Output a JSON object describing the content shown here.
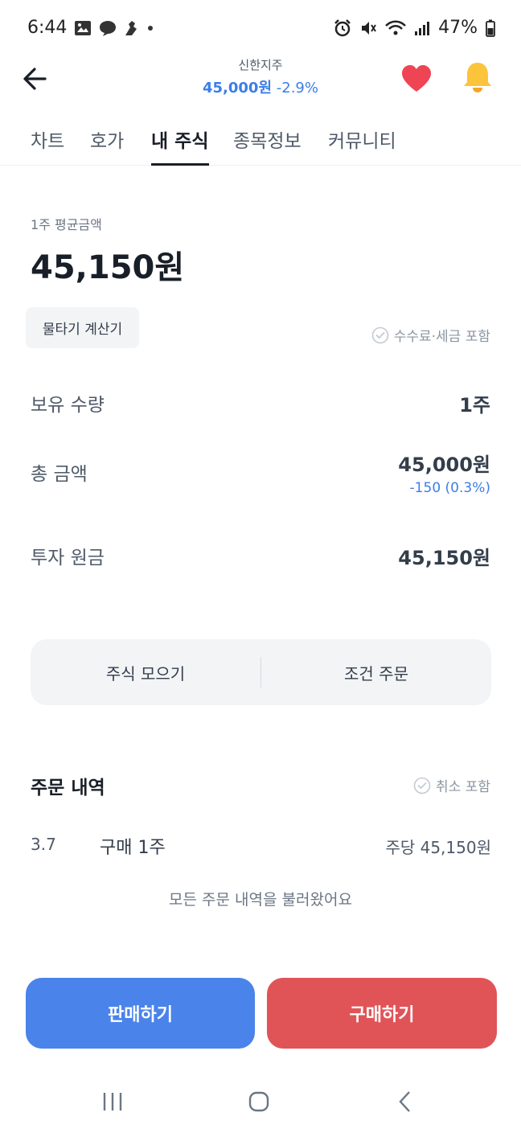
{
  "status_bar": {
    "time": "6:44",
    "battery": "47%"
  },
  "header": {
    "stock_name": "신한지주",
    "price": "45,000원",
    "change": "-2.9%"
  },
  "tabs": [
    {
      "label": "차트"
    },
    {
      "label": "호가"
    },
    {
      "label": "내 주식",
      "active": true
    },
    {
      "label": "종목정보"
    },
    {
      "label": "커뮤니티"
    }
  ],
  "holding": {
    "avg_label": "1주 평균금액",
    "avg_value": "45,150원",
    "calc_button": "물타기 계산기",
    "fee_check_label": "수수료·세금 포함",
    "rows": {
      "quantity": {
        "label": "보유 수량",
        "value": "1주"
      },
      "total": {
        "label": "총 금액",
        "value": "45,000원",
        "sub": "-150 (0.3%)"
      },
      "principal": {
        "label": "투자 원금",
        "value": "45,150원"
      }
    }
  },
  "actions": {
    "collect": "주식 모으기",
    "conditional": "조건 주문"
  },
  "orders": {
    "title": "주문 내역",
    "cancel_check_label": "취소 포함",
    "items": [
      {
        "date": "3.7",
        "desc": "구매 1주",
        "price": "주당 45,150원"
      }
    ],
    "loaded_msg": "모든 주문 내역을 불러왔어요"
  },
  "buttons": {
    "sell": "판매하기",
    "buy": "구매하기"
  },
  "colors": {
    "accent_blue": "#3c7ee8",
    "sell_blue": "#4a83ea",
    "buy_red": "#e05458",
    "heart": "#ee4454",
    "bell": "#fcc43b"
  },
  "icons": [
    "gallery-icon",
    "chat-icon",
    "tool-icon",
    "alarm-icon",
    "mute-icon",
    "wifi-icon",
    "signal-icon",
    "battery-icon",
    "back-arrow-icon",
    "heart-icon",
    "bell-icon",
    "check-circle-icon"
  ]
}
